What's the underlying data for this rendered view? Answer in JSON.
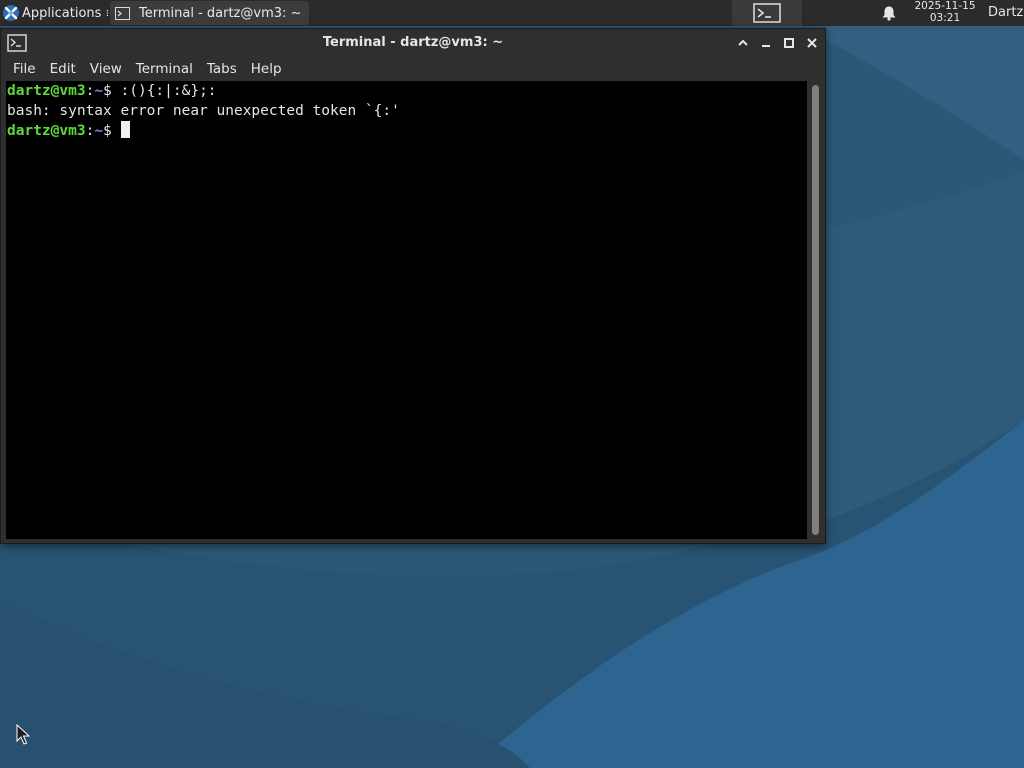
{
  "panel": {
    "applications_label": "Applications ≡",
    "task_label": "Terminal - dartz@vm3: ~",
    "clock_date": "2025-11-15",
    "clock_time": "03:21",
    "user_label": "Dartz",
    "icons": {
      "apps_logo": "xfce-logo-icon",
      "task_icon": "terminal-icon",
      "launcher_icon": "terminal-icon",
      "notification_icon": "bell-icon"
    }
  },
  "window": {
    "title": "Terminal - dartz@vm3: ~",
    "icon": "terminal-icon",
    "controls": {
      "shade": "chevron-up-icon",
      "minimize": "minimize-icon",
      "maximize": "maximize-icon",
      "close": "close-icon"
    }
  },
  "menu": {
    "items": [
      "File",
      "Edit",
      "View",
      "Terminal",
      "Tabs",
      "Help"
    ]
  },
  "terminal": {
    "lines": [
      {
        "user": "dartz@vm3",
        "sep": ":",
        "path": "~",
        "symbol": "$",
        "command": " :(){:|:&};:"
      },
      {
        "text": "bash: syntax error near unexpected token `{:'"
      },
      {
        "user": "dartz@vm3",
        "sep": ":",
        "path": "~",
        "symbol": "$",
        "command": " "
      }
    ]
  },
  "colors": {
    "prompt_user": "#5fd93a",
    "prompt_path": "#6c8cd5",
    "terminal_bg": "#000000",
    "terminal_fg": "#e5e5e5",
    "desktop_bg": "#2c5878",
    "panel_bg": "#2b2b2b"
  }
}
